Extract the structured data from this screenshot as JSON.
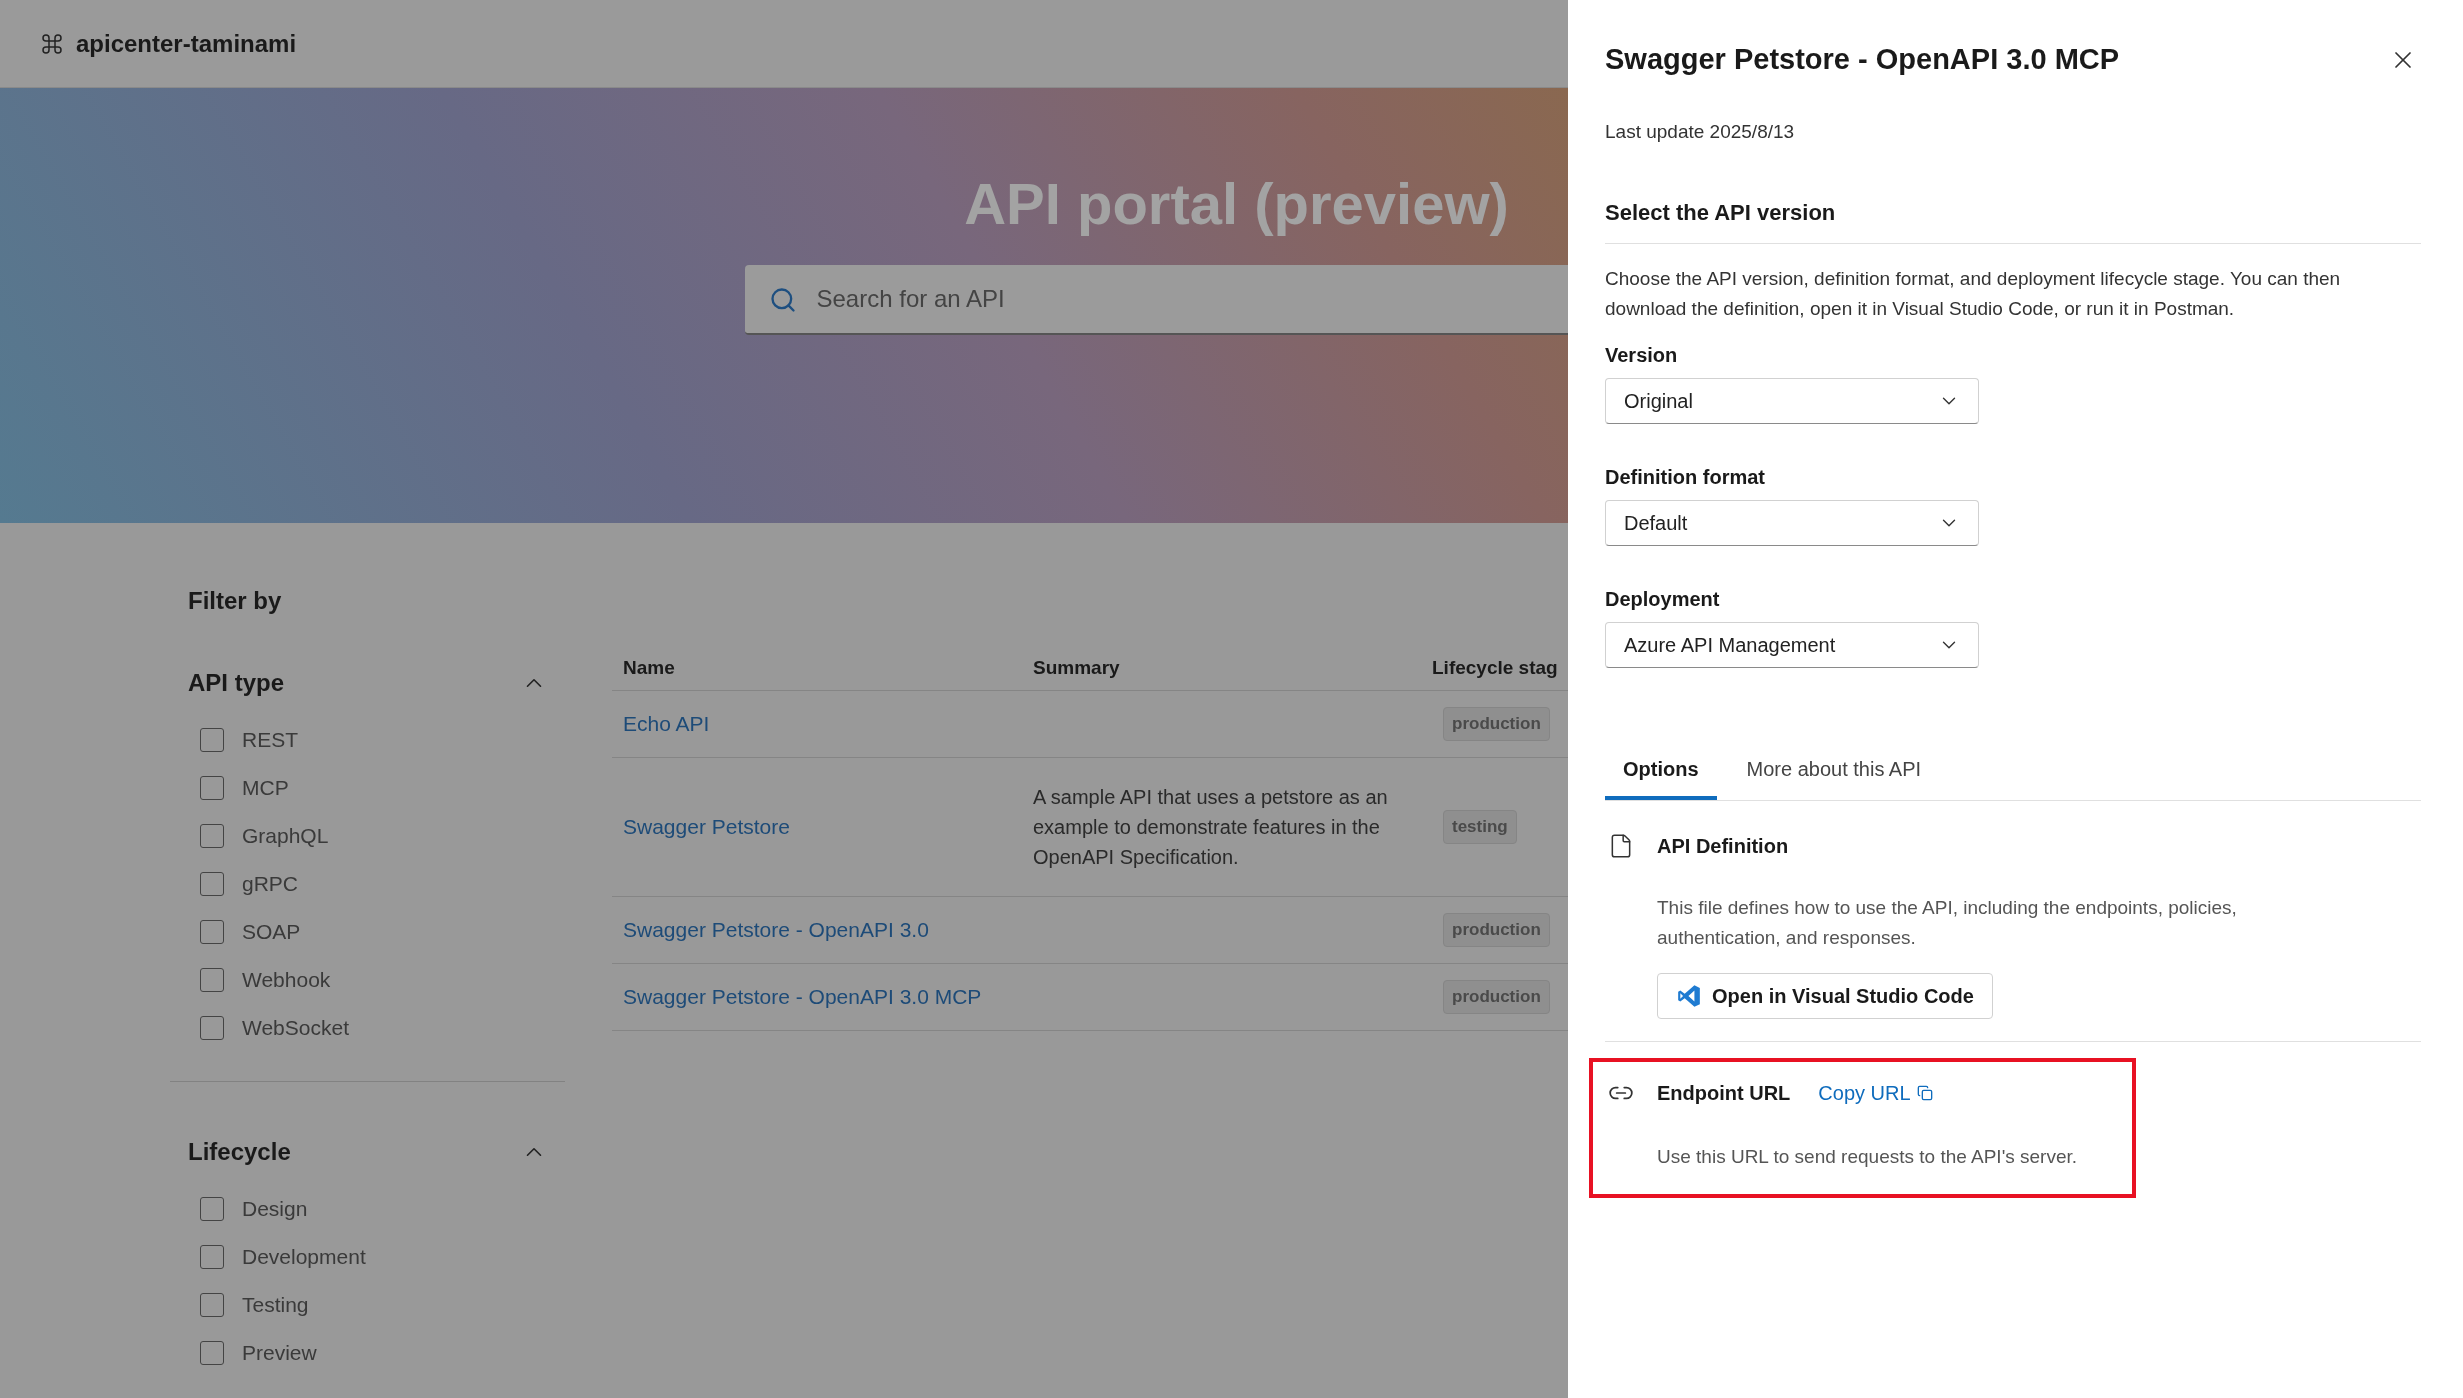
{
  "header": {
    "title": "apicenter-taminami"
  },
  "hero": {
    "title": "API portal (preview)",
    "search": {
      "placeholder": "Search for an API"
    }
  },
  "filters": {
    "title": "Filter by",
    "groups": [
      {
        "title": "API type",
        "expanded": true,
        "options": [
          {
            "label": "REST",
            "checked": false
          },
          {
            "label": "MCP",
            "checked": false
          },
          {
            "label": "GraphQL",
            "checked": false
          },
          {
            "label": "gRPC",
            "checked": false
          },
          {
            "label": "SOAP",
            "checked": false
          },
          {
            "label": "Webhook",
            "checked": false
          },
          {
            "label": "WebSocket",
            "checked": false
          }
        ]
      },
      {
        "title": "Lifecycle",
        "expanded": true,
        "options": [
          {
            "label": "Design",
            "checked": false
          },
          {
            "label": "Development",
            "checked": false
          },
          {
            "label": "Testing",
            "checked": false
          },
          {
            "label": "Preview",
            "checked": false
          }
        ]
      }
    ]
  },
  "table": {
    "columns": [
      "Name",
      "Summary",
      "Lifecycle stag"
    ],
    "rows": [
      {
        "name": "Echo API",
        "stage": "production"
      },
      {
        "name": "Swagger Petstore",
        "summary": "A sample API that uses a petstore as an example to demonstrate features in the OpenAPI Specification.",
        "stage": "testing"
      },
      {
        "name": "Swagger Petstore - OpenAPI 3.0",
        "stage": "production"
      },
      {
        "name": "Swagger Petstore - OpenAPI 3.0 MCP",
        "stage": "production"
      }
    ]
  },
  "panel": {
    "title": "Swagger Petstore - OpenAPI 3.0 MCP",
    "last_update": "Last update 2025/8/13",
    "section_title": "Select the API version",
    "description": "Choose the API version, definition format, and deployment lifecycle stage. You can then download the definition, open it in Visual Studio Code, or run it in Postman.",
    "selects": [
      {
        "label": "Version",
        "value": "Original"
      },
      {
        "label": "Definition format",
        "value": "Default"
      },
      {
        "label": "Deployment",
        "value": "Azure API Management"
      }
    ],
    "tabs": [
      {
        "label": "Options",
        "selected": true
      },
      {
        "label": "More about this API",
        "selected": false
      }
    ],
    "sections": [
      {
        "kind": "file",
        "title": "API Definition",
        "description": "This file defines how to use the API, including the endpoints, policies, authentication, and responses.",
        "button": "Open in Visual Studio Code",
        "highlighted": false
      },
      {
        "kind": "link",
        "title": "Endpoint URL",
        "link": "Copy URL",
        "description": "Use this URL to send requests to the API's server.",
        "highlighted": true
      }
    ]
  }
}
